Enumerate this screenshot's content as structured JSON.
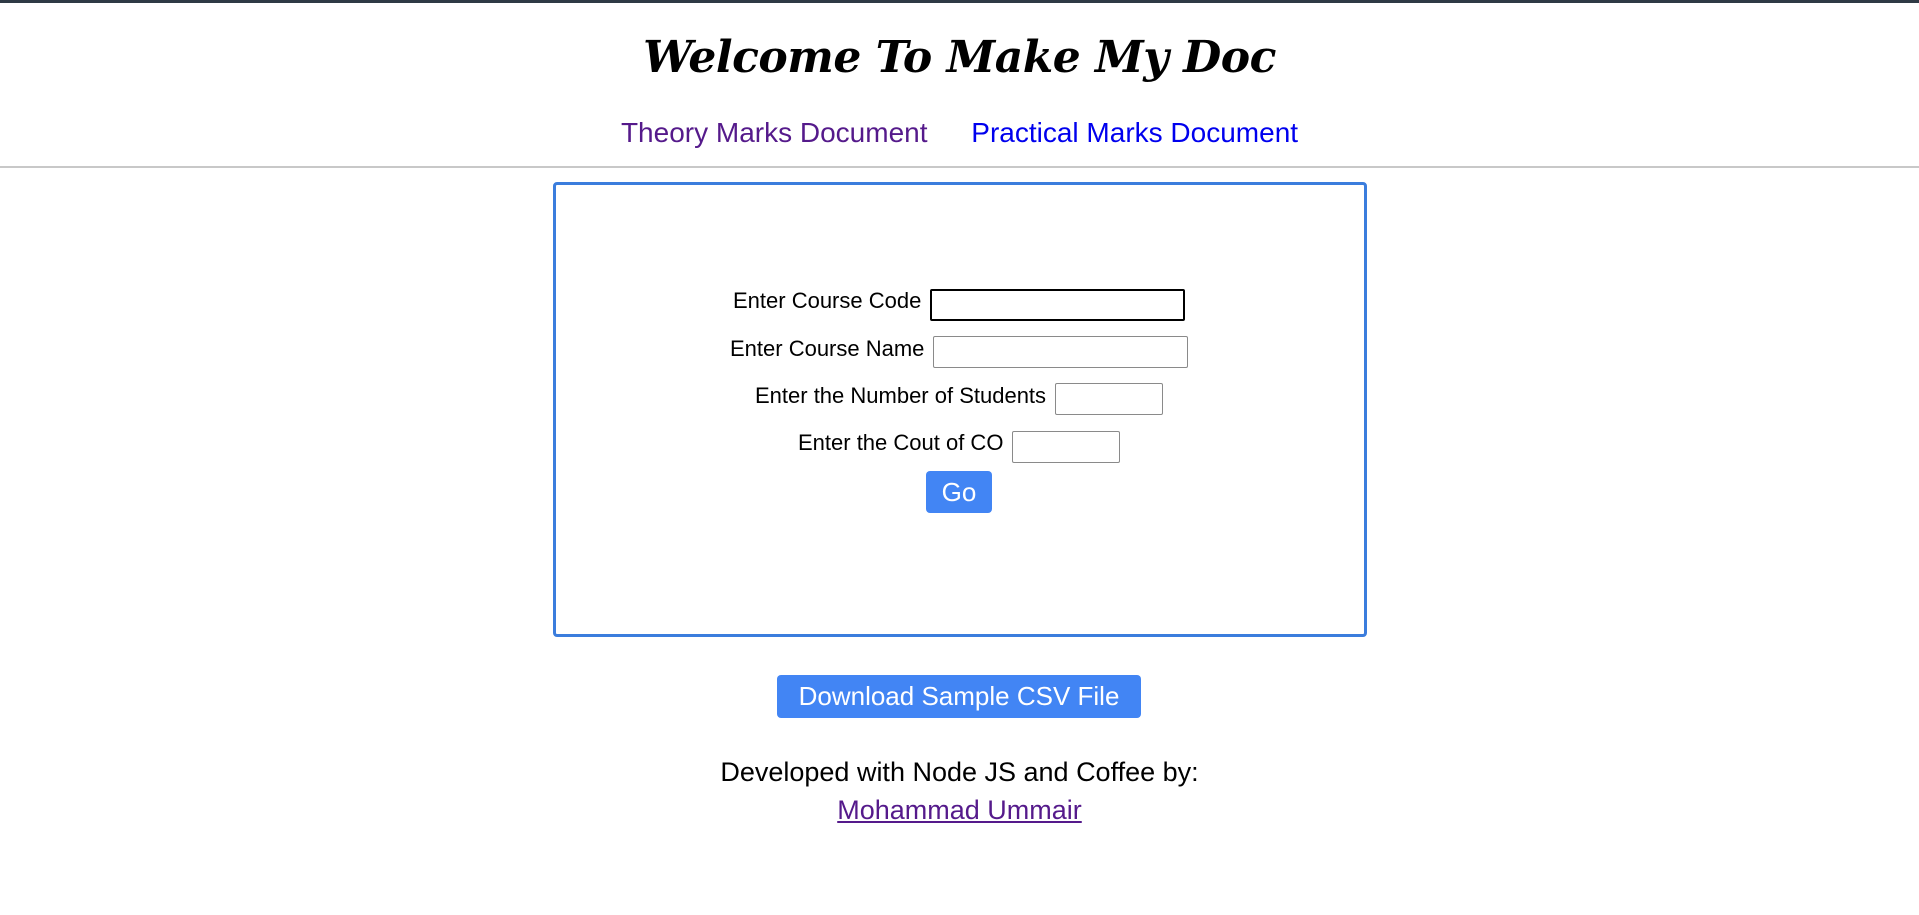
{
  "header": {
    "title": "Welcome To Make My Doc"
  },
  "nav": {
    "theory_label": "Theory Marks Document",
    "practical_label": "Practical Marks Document"
  },
  "form": {
    "course_code": {
      "label": "Enter Course Code",
      "value": ""
    },
    "course_name": {
      "label": "Enter Course Name",
      "value": ""
    },
    "num_students": {
      "label": "Enter the Number of Students",
      "value": ""
    },
    "co_count": {
      "label": "Enter the Cout of CO",
      "value": ""
    },
    "submit_label": "Go"
  },
  "download": {
    "label": "Download Sample CSV File"
  },
  "footer": {
    "text": "Developed with Node JS and Coffee by:",
    "author": "Mohammad Ummair"
  },
  "colors": {
    "accent": "#4285f4",
    "card_border": "#3b7ddd",
    "visited_link": "#551a8b",
    "link": "#0000ee"
  }
}
